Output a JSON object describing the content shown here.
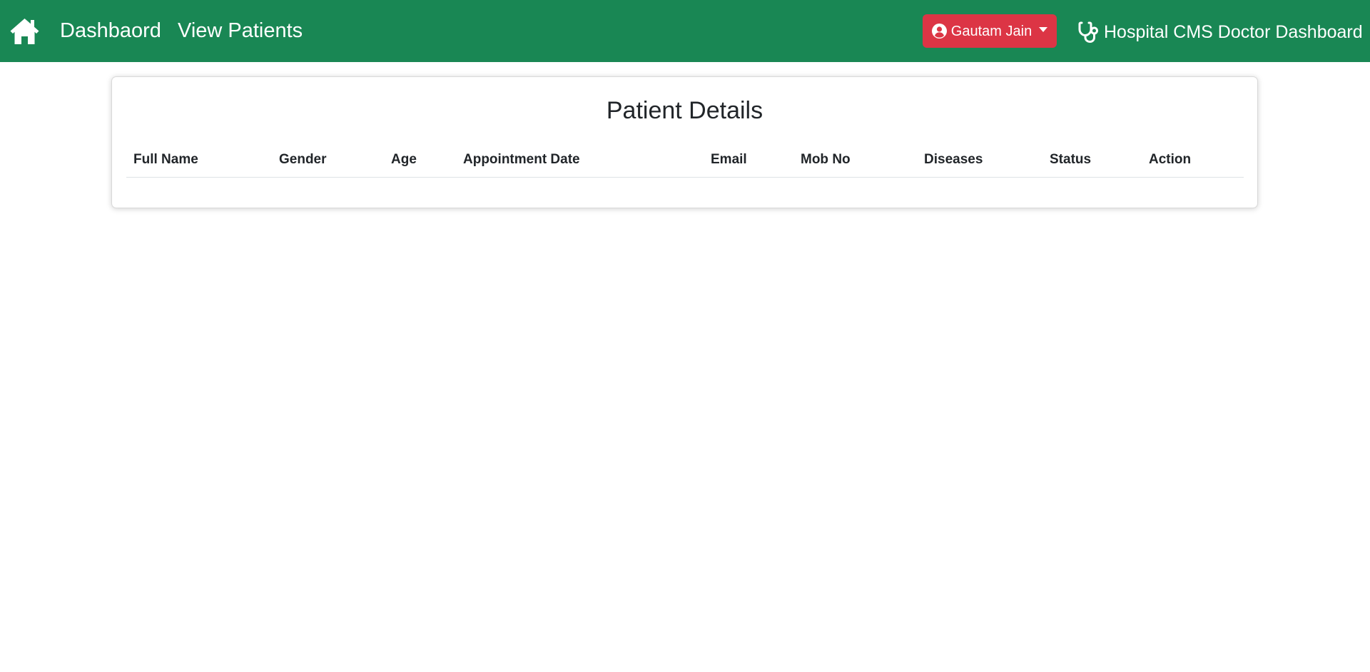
{
  "navbar": {
    "bg_color": "#198754",
    "home_icon": "home-icon",
    "links": [
      {
        "label": "Dashbaord"
      },
      {
        "label": "View Patients"
      }
    ],
    "user_menu": {
      "name": "Gautam Jain",
      "icon": "user-circle-icon",
      "bg_color": "#dc3545"
    },
    "brand": {
      "icon": "stethoscope-icon",
      "text": "Hospital CMS Doctor Dashboard"
    }
  },
  "main": {
    "card_title": "Patient Details",
    "table": {
      "columns": [
        "Full Name",
        "Gender",
        "Age",
        "Appointment Date",
        "Email",
        "Mob No",
        "Diseases",
        "Status",
        "Action"
      ],
      "rows": []
    }
  }
}
